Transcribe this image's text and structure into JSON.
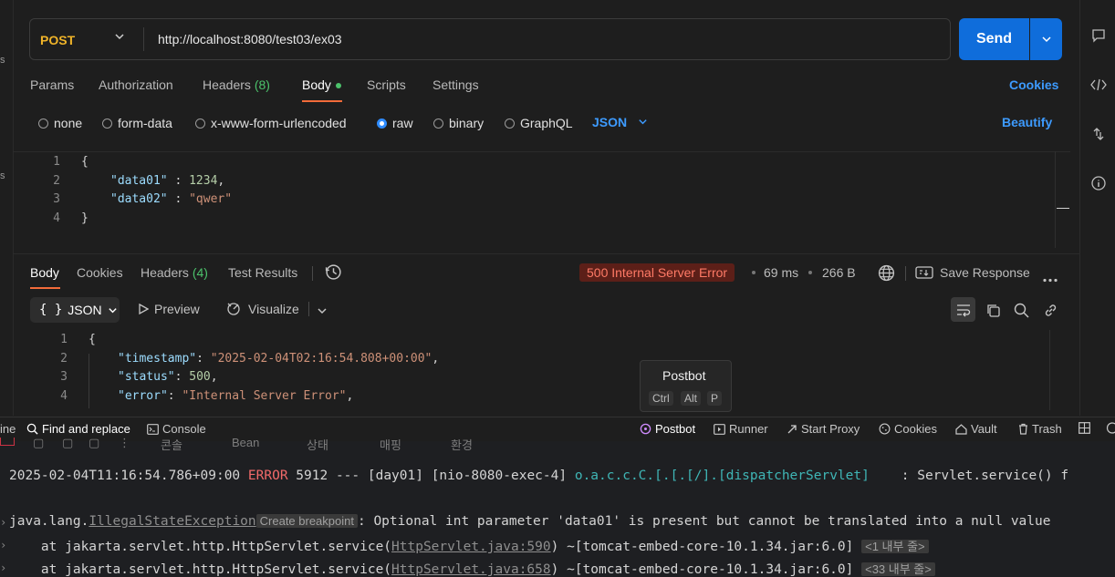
{
  "left_gutter": {
    "labels": [
      "s",
      "s"
    ]
  },
  "request": {
    "method": "POST",
    "url": "http://localhost:8080/test03/ex03",
    "send_label": "Send"
  },
  "request_tabs": [
    {
      "label": "Params"
    },
    {
      "label": "Authorization"
    },
    {
      "label": "Headers",
      "count": "(8)"
    },
    {
      "label": "Body"
    },
    {
      "label": "Scripts"
    },
    {
      "label": "Settings"
    }
  ],
  "cookies_link": "Cookies",
  "body_types": [
    "none",
    "form-data",
    "x-www-form-urlencoded",
    "raw",
    "binary",
    "GraphQL"
  ],
  "body_format": "JSON",
  "beautify_label": "Beautify",
  "request_body": {
    "line_numbers": [
      "1",
      "2",
      "3",
      "4"
    ],
    "open": "{",
    "close": "}",
    "k1": "\"data01\"",
    "v1": "1234",
    "k2": "\"data02\"",
    "v2": "\"qwer\""
  },
  "response_tabs": [
    {
      "label": "Body"
    },
    {
      "label": "Cookies"
    },
    {
      "label": "Headers",
      "count": "(4)"
    },
    {
      "label": "Test Results"
    }
  ],
  "response_meta": {
    "status": "500 Internal Server Error",
    "time": "69 ms",
    "size": "266 B",
    "save_label": "Save Response"
  },
  "response_toolbar": {
    "format_icon": "{ }",
    "format": "JSON",
    "preview": "Preview",
    "visualize": "Visualize"
  },
  "response_body": {
    "line_numbers": [
      "1",
      "2",
      "3",
      "4"
    ],
    "open": "{",
    "k1": "\"timestamp\"",
    "v1": "\"2025-02-04T02:16:54.808+00:00\"",
    "k2": "\"status\"",
    "v2": "500",
    "k3": "\"error\"",
    "v3": "\"Internal Server Error\""
  },
  "tooltip": {
    "title": "Postbot",
    "keys": [
      "Ctrl",
      "Alt",
      "P"
    ]
  },
  "status_bar": {
    "left_cut": "ine",
    "find": "Find and replace",
    "console": "Console",
    "postbot": "Postbot",
    "runner": "Runner",
    "proxy": "Start Proxy",
    "cookies": "Cookies",
    "vault": "Vault",
    "trash": "Trash"
  },
  "ide_tabs": [
    "콘솔",
    "Bean",
    "상태",
    "매핑",
    "환경"
  ],
  "console": {
    "l1_time": "2025-02-04T11:16:54.786+09:00",
    "l1_level": "ERROR",
    "l1_mid": " 5912 --- [day01] [nio-8080-exec-4] ",
    "l1_logger": "o.a.c.c.C.[.[.[/].[dispatcherServlet]",
    "l1_msg": "    : Servlet.service() f",
    "l2_pkg": "java.lang.",
    "l2_exc": "IllegalStateException",
    "l2_chip": "Create breakpoint",
    "l2_msg": ": Optional int parameter 'data01' is present but cannot be translated into a null value",
    "l3_prefix": "    at jakarta.servlet.http.HttpServlet.service(",
    "l3_link": "HttpServlet.java:590",
    "l3_suffix": ") ~[tomcat-embed-core-10.1.34.jar:6.0]",
    "l3_chip": "<1 내부 줄>",
    "l4_prefix": "    at jakarta.servlet.http.HttpServlet.service(",
    "l4_link": "HttpServlet.java:658",
    "l4_suffix": ") ~[tomcat-embed-core-10.1.34.jar:6.0]",
    "l4_chip": "<33 내부 줄>"
  },
  "colors": {
    "accent": "#0f6ddb",
    "method": "#f0b429",
    "error_badge": "#5c1f18",
    "tab_underline": "#f26b3a"
  }
}
